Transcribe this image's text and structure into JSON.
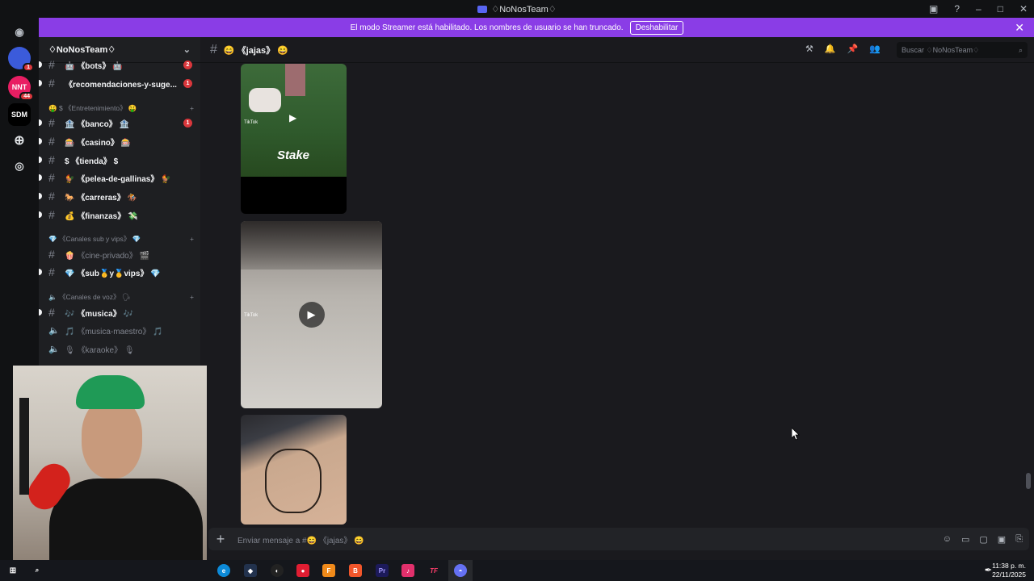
{
  "window": {
    "title": "♢NoNosTeam♢"
  },
  "banner": {
    "text": "El modo Streamer está habilitado. Los nombres de usuario se han truncado.",
    "button": "Deshabilitar"
  },
  "rail": {
    "servers": [
      {
        "label": "",
        "badge": "1",
        "color": "#5865f2"
      },
      {
        "label": "NNT",
        "badge": "44",
        "color": "#e91e63"
      },
      {
        "label": "SDM",
        "badge": "",
        "color": "#000000"
      }
    ]
  },
  "server": {
    "name": "♢NoNosTeam♢"
  },
  "channels": [
    {
      "name": "🤖 《bots》 🤖",
      "count": "2",
      "muted": false
    },
    {
      "name": "《recomendaciones-y-suge...",
      "count": "1",
      "muted": false
    },
    {
      "name": "🏦 《banco》 🏦",
      "count": "1",
      "muted": false
    },
    {
      "name": "🎰 《casino》 🎰",
      "count": "",
      "muted": false
    },
    {
      "name": "$ 《tienda》 $",
      "count": "",
      "muted": false
    },
    {
      "name": "🐓 《pelea-de-gallinas》 🐓",
      "count": "",
      "muted": false
    },
    {
      "name": "🐎 《carreras》 🏇",
      "count": "",
      "muted": false
    },
    {
      "name": "💰 《finanzas》 💸",
      "count": "",
      "muted": false
    },
    {
      "name": "🍿 《cine-privado》 🎬",
      "count": "",
      "muted": true
    },
    {
      "name": "💎 《sub🥇y🥇vips》 💎",
      "count": "",
      "muted": false
    },
    {
      "name": "🎶 《musica》 🎶",
      "count": "",
      "muted": false
    },
    {
      "name": "🎵 《musica-maestro》 🎵",
      "count": "",
      "muted": true
    },
    {
      "name": "🎙 《karaoke》 🎙",
      "count": "",
      "muted": true
    }
  ],
  "categories": [
    "🤑 $ 《Entretenimiento》 🤑",
    "💎 《Canales sub y vips》 💎",
    "🔈 《Canales de voz》 🗣"
  ],
  "channel": {
    "name": "😄 《jajas》 😄"
  },
  "search": {
    "placeholder": "Buscar ♢NoNosTeam♢"
  },
  "media": [
    {
      "label": "TikTok",
      "overlay": "Stake"
    },
    {
      "label": "TikTok",
      "overlay": ""
    },
    {
      "label": "",
      "overlay": ""
    }
  ],
  "composer": {
    "placeholder": "Enviar mensaje a #😄 《jajas》 😄"
  },
  "taskbar": {
    "time": "11:38 p. m.",
    "date": "22/11/2025"
  }
}
